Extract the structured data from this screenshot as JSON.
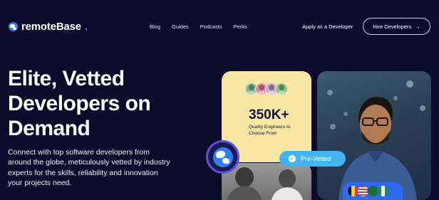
{
  "brand": {
    "name": "remoteBase",
    "dot": "."
  },
  "nav": {
    "links": [
      "Blog",
      "Guides",
      "Podcasts",
      "Perks"
    ],
    "apply": "Apply as a Developer",
    "hire": "Hire Developers",
    "hire_arrow": "→"
  },
  "hero": {
    "title_line1": "Elite, Vetted",
    "title_line2": "Developers on",
    "title_line3": "Demand",
    "subtitle": "Connect with top software developers from around the globe, meticulously vetted by industry experts for the skills, reliability and innovation your projects need."
  },
  "stats_card": {
    "value": "350K+",
    "label": "Quality Engineers to Choose From",
    "avatar_colors": [
      "#7bc0a8",
      "#e18aa0",
      "#c7a8e0",
      "#8fc58a"
    ]
  },
  "badge": {
    "label": "Pre-Vetted",
    "icon": "check-icon"
  },
  "flags": [
    "Belgium",
    "United States",
    "Pakistan",
    "Nigeria"
  ],
  "colors": {
    "background": "#0d0b2b",
    "accent": "#2f7cf5",
    "card_yellow": "#f8e6a4",
    "pill": "#43b4f0"
  }
}
